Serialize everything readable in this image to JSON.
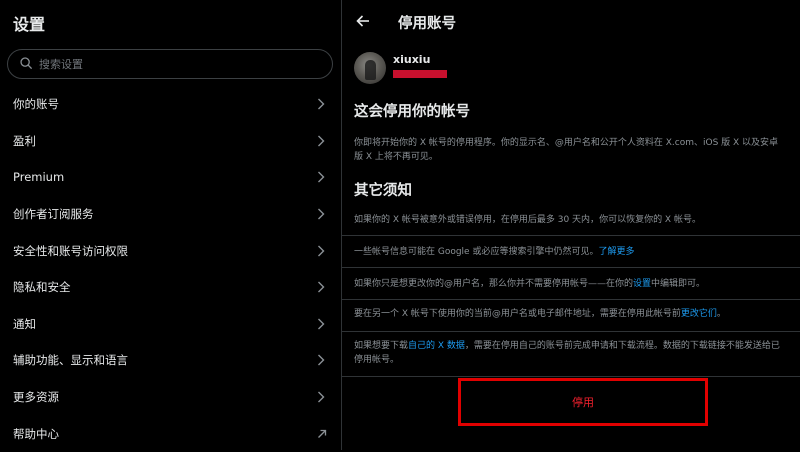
{
  "left": {
    "title": "设置",
    "search_placeholder": "搜索设置",
    "items": [
      {
        "label": "你的账号",
        "icon": "chevron-right-icon"
      },
      {
        "label": "盈利",
        "icon": "chevron-right-icon"
      },
      {
        "label": "Premium",
        "icon": "chevron-right-icon"
      },
      {
        "label": "创作者订阅服务",
        "icon": "chevron-right-icon"
      },
      {
        "label": "安全性和账号访问权限",
        "icon": "chevron-right-icon"
      },
      {
        "label": "隐私和安全",
        "icon": "chevron-right-icon"
      },
      {
        "label": "通知",
        "icon": "chevron-right-icon"
      },
      {
        "label": "辅助功能、显示和语言",
        "icon": "chevron-right-icon"
      },
      {
        "label": "更多资源",
        "icon": "chevron-right-icon"
      },
      {
        "label": "帮助中心",
        "icon": "external-link-icon"
      }
    ]
  },
  "right": {
    "title": "停用账号",
    "user": {
      "name": "xiuxiu"
    },
    "section1": {
      "heading": "这会停用你的帐号",
      "text": "你即将开始你的 X 帐号的停用程序。你的显示名、@用户名和公开个人资料在 X.com、iOS 版 X 以及安卓版 X 上将不再可见。"
    },
    "section2": {
      "heading": "其它须知",
      "notes": [
        {
          "text": "如果你的 X 帐号被意外或错误停用，在停用后最多 30 天内，你可以恢复你的 X 帐号。"
        },
        {
          "before": "一些帐号信息可能在 Google 或必应等搜索引擎中仍然可见。",
          "link": "了解更多",
          "after": ""
        },
        {
          "before": "如果你只是想更改你的@用户名，那么你并不需要停用帐号——在你的",
          "link": "设置",
          "after": "中编辑即可。"
        },
        {
          "before": "要在另一个 X 帐号下使用你的当前@用户名或电子邮件地址，需要在停用此帐号前",
          "link": "更改它们",
          "after": "。"
        },
        {
          "before": "如果想要下载",
          "link": "自己的 X 数据",
          "after": "，需要在停用自己的账号前完成申请和下载流程。数据的下载链接不能发送给已停用帐号。"
        }
      ]
    },
    "deactivate_label": "停用"
  },
  "colors": {
    "background": "#000000",
    "text": "#e7e9ea",
    "muted": "#8b9196",
    "link": "#1d9bf0",
    "danger": "#f4212e",
    "highlight_box": "#e00000",
    "divider": "#2f3336"
  }
}
